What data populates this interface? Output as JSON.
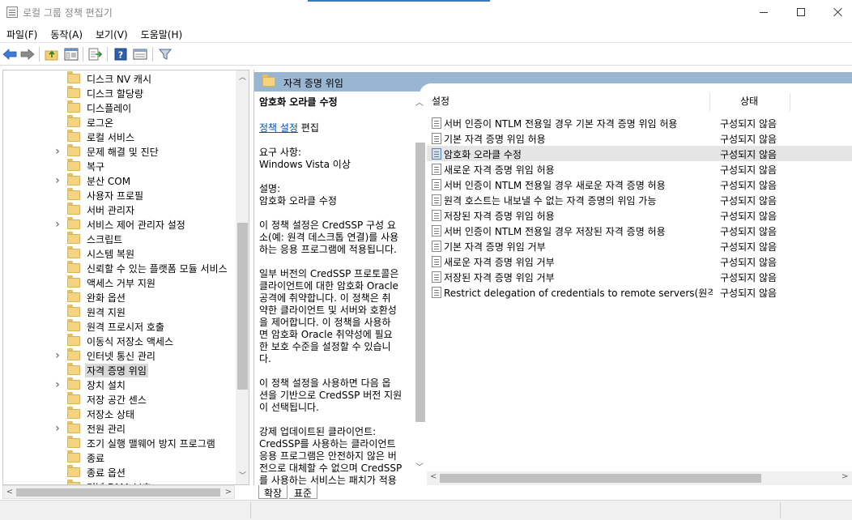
{
  "window": {
    "title": "로컬 그룹 정책 편집기"
  },
  "menu": {
    "items": [
      "파일(F)",
      "동작(A)",
      "보기(V)",
      "도움말(H)"
    ]
  },
  "toolbar": {
    "icons": [
      "back-arrow-icon",
      "forward-arrow-icon",
      "up-folder-icon",
      "show-hide-tree-icon",
      "export-list-icon",
      "help-icon",
      "properties-view-icon",
      "filter-icon"
    ]
  },
  "tree": {
    "items": [
      {
        "label": "디스크 NV 캐시",
        "expandable": false
      },
      {
        "label": "디스크 할당량",
        "expandable": false
      },
      {
        "label": "디스플레이",
        "expandable": false
      },
      {
        "label": "로그온",
        "expandable": false
      },
      {
        "label": "로컬 서비스",
        "expandable": false
      },
      {
        "label": "문제 해결 및 진단",
        "expandable": true
      },
      {
        "label": "복구",
        "expandable": false
      },
      {
        "label": "분산 COM",
        "expandable": true
      },
      {
        "label": "사용자 프로필",
        "expandable": false
      },
      {
        "label": "서버 관리자",
        "expandable": false
      },
      {
        "label": "서비스 제어 관리자 설정",
        "expandable": true
      },
      {
        "label": "스크립트",
        "expandable": false
      },
      {
        "label": "시스템 복원",
        "expandable": false
      },
      {
        "label": "신뢰할 수 있는 플랫폼 모듈 서비스",
        "expandable": false
      },
      {
        "label": "액세스 거부 지원",
        "expandable": false
      },
      {
        "label": "완화 옵션",
        "expandable": false
      },
      {
        "label": "원격 지원",
        "expandable": false
      },
      {
        "label": "원격 프로시저 호출",
        "expandable": false
      },
      {
        "label": "이동식 저장소 액세스",
        "expandable": false
      },
      {
        "label": "인터넷 통신 관리",
        "expandable": true
      },
      {
        "label": "자격 증명 위임",
        "expandable": false,
        "selected": true
      },
      {
        "label": "장치 설치",
        "expandable": true
      },
      {
        "label": "저장 공간 센스",
        "expandable": false
      },
      {
        "label": "저장소 상태",
        "expandable": false
      },
      {
        "label": "전원 관리",
        "expandable": true
      },
      {
        "label": "조기 실행 맬웨어 방지 프로그램",
        "expandable": false
      },
      {
        "label": "종료",
        "expandable": false
      },
      {
        "label": "종료 옵션",
        "expandable": false
      },
      {
        "label": "커널 DMA 보호",
        "expandable": false
      }
    ]
  },
  "header": {
    "title": "자격 증명 위임"
  },
  "description": {
    "title": "암호화 오라클 수정",
    "edit_link": "정책 설정",
    "edit_suffix": " 편집",
    "requirement": "요구 사항:\nWindows Vista 이상",
    "desc_label": "설명:\n암호화 오라클 수정",
    "para1": "이 정책 설정은 CredSSP 구성 요\n소(예: 원격 데스크톱 연결)를 사용\n하는 응용 프로그램에 적용됩니다.",
    "para2": "일부 버전의 CredSSP 프로토콜은\n클라이언트에 대한 암호화 Oracle\n공격에 취약합니다.  이 정책은 취\n약한 클라이언트 및 서버와 호환성\n을 제어합니다.  이 정책을 사용하\n면 암호화 Oracle 취약성에 필요\n한 보호 수준을 설정할 수 있습니\n다.",
    "para3": "이 정책 설정을 사용하면 다음 옵\n션을 기반으로 CredSSP 버전 지원\n이 선택됩니다.",
    "para4": "강제 업데이트된 클라이언트:\nCredSSP를 사용하는 클라이언트\n응용 프로그램은 안전하지 않은 버\n전으로 대체할 수 없으며 CredSSP\n를 사용하는 서비스는 패치가 적용"
  },
  "list": {
    "col_setting": "설정",
    "col_state": "상태",
    "rows": [
      {
        "name": "서버 인증이 NTLM 전용일 경우 기본 자격 증명 위임 허용",
        "state": "구성되지 않음"
      },
      {
        "name": "기본 자격 증명 위임 허용",
        "state": "구성되지 않음"
      },
      {
        "name": "암호화 오라클 수정",
        "state": "구성되지 않음",
        "selected": true
      },
      {
        "name": "새로운 자격 증명 위임 허용",
        "state": "구성되지 않음"
      },
      {
        "name": "서버 인증이 NTLM 전용일 경우 새로운 자격 증명 허용",
        "state": "구성되지 않음"
      },
      {
        "name": "원격 호스트는 내보낼 수 없는 자격 증명의 위임 가능",
        "state": "구성되지 않음"
      },
      {
        "name": "저장된 자격 증명 위임 허용",
        "state": "구성되지 않음"
      },
      {
        "name": "서버 인증이 NTLM 전용일 경우 저장된 자격 증명 허용",
        "state": "구성되지 않음"
      },
      {
        "name": "기본 자격 증명 위임 거부",
        "state": "구성되지 않음"
      },
      {
        "name": "새로운 자격 증명 위임 거부",
        "state": "구성되지 않음"
      },
      {
        "name": "저장된 자격 증명 위임 거부",
        "state": "구성되지 않음"
      },
      {
        "name": "Restrict delegation of credentials to remote servers(원격 서...",
        "state": "구성되지 않음"
      }
    ]
  },
  "tabs": {
    "extended": "확장",
    "standard": "표준"
  }
}
